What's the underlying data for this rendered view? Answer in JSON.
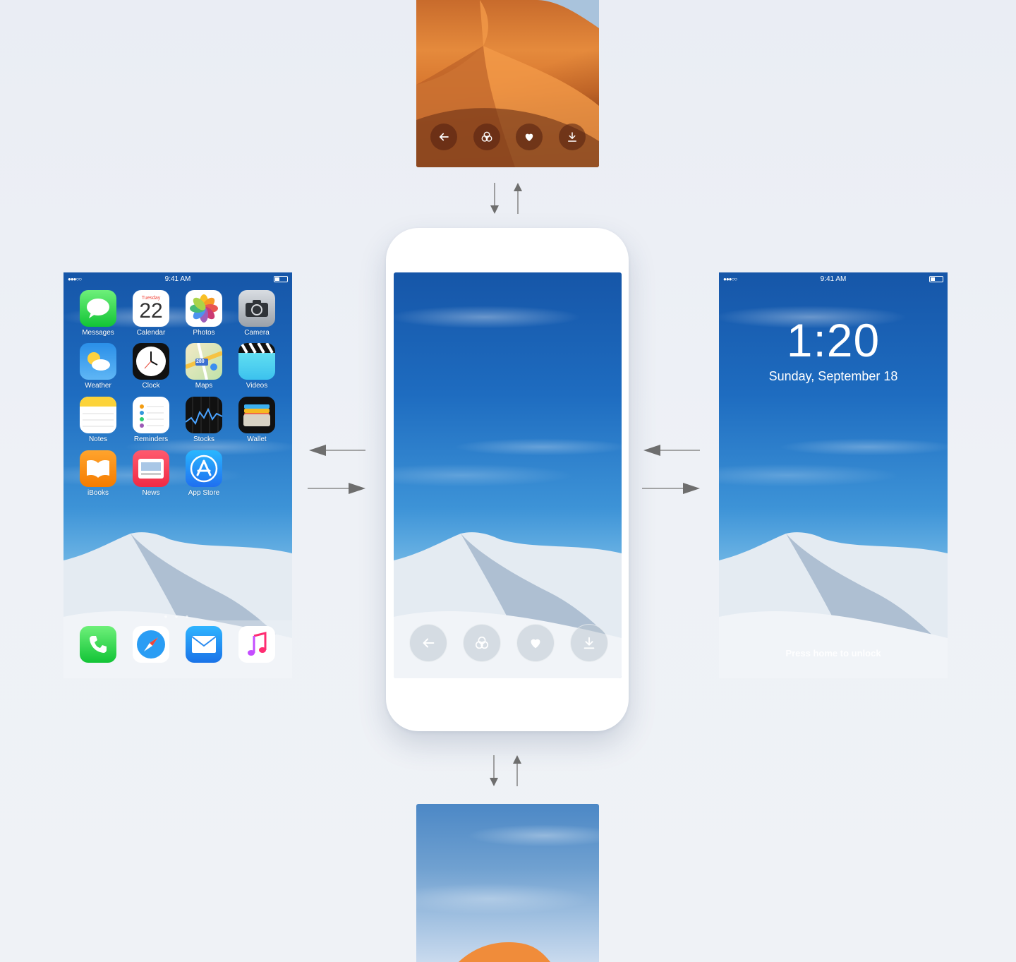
{
  "status_bar": {
    "time": "9:41 AM",
    "signal": "●●●○○"
  },
  "home_screen": {
    "apps": [
      {
        "label": "Messages",
        "icon": "messages-icon"
      },
      {
        "label": "Calendar",
        "icon": "calendar-icon"
      },
      {
        "label": "Photos",
        "icon": "photos-icon"
      },
      {
        "label": "Camera",
        "icon": "camera-icon"
      },
      {
        "label": "Weather",
        "icon": "weather-icon"
      },
      {
        "label": "Clock",
        "icon": "clock-icon"
      },
      {
        "label": "Maps",
        "icon": "maps-icon"
      },
      {
        "label": "Videos",
        "icon": "videos-icon"
      },
      {
        "label": "Notes",
        "icon": "notes-icon"
      },
      {
        "label": "Reminders",
        "icon": "reminders-icon"
      },
      {
        "label": "Stocks",
        "icon": "stocks-icon"
      },
      {
        "label": "Wallet",
        "icon": "wallet-icon"
      },
      {
        "label": "iBooks",
        "icon": "ibooks-icon"
      },
      {
        "label": "News",
        "icon": "news-icon"
      },
      {
        "label": "App Store",
        "icon": "app-store-icon"
      }
    ],
    "calendar_day": "Tuesday",
    "calendar_date": "22",
    "maps_shield": "280",
    "dock": [
      "phone-icon",
      "safari-icon",
      "mail-icon",
      "music-icon"
    ],
    "page_dots": "● ● ●"
  },
  "lock_screen": {
    "time": "1:20",
    "date": "Sunday, September 18",
    "hint": "Press home to unlock"
  },
  "actions": [
    {
      "name": "back",
      "icon": "arrow-left-icon"
    },
    {
      "name": "filters",
      "icon": "filters-icon"
    },
    {
      "name": "favorite",
      "icon": "heart-icon"
    },
    {
      "name": "download",
      "icon": "download-icon"
    }
  ],
  "colors": {
    "background": "#eceff5",
    "sky_top": "#1656a8",
    "desert_orange": "#e58a3c",
    "arrow_gray": "#7a7a7a"
  }
}
